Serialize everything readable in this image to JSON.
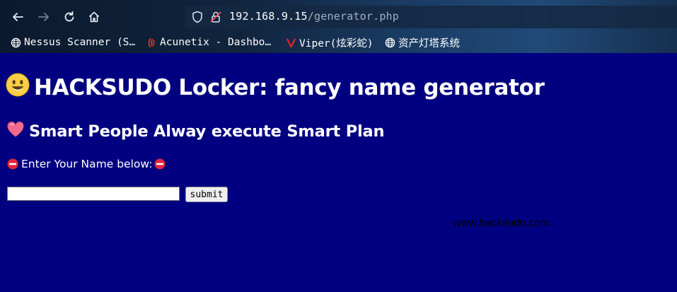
{
  "browser": {
    "url_host": "192.168.9.15",
    "url_path": "/generator.php",
    "bookmarks": [
      {
        "label": "Nessus Scanner (S…",
        "icon": "globe-icon"
      },
      {
        "label": "Acunetix - Dashbo…",
        "icon": "acunetix-icon"
      },
      {
        "label": "Viper(炫彩蛇)",
        "icon": "viper-icon"
      },
      {
        "label": "资产灯塔系统",
        "icon": "globe-icon"
      }
    ]
  },
  "page": {
    "title": "HACKSUDO Locker: fancy name generator",
    "subtitle": "Smart People Alway execute Smart Plan",
    "prompt": "Enter Your Name below:",
    "input_value": "",
    "submit_label": "submit",
    "site_text": "www.hacksudo.com"
  },
  "colors": {
    "page_background": "#000080",
    "text": "#ffffff",
    "site_text": "#000000"
  }
}
